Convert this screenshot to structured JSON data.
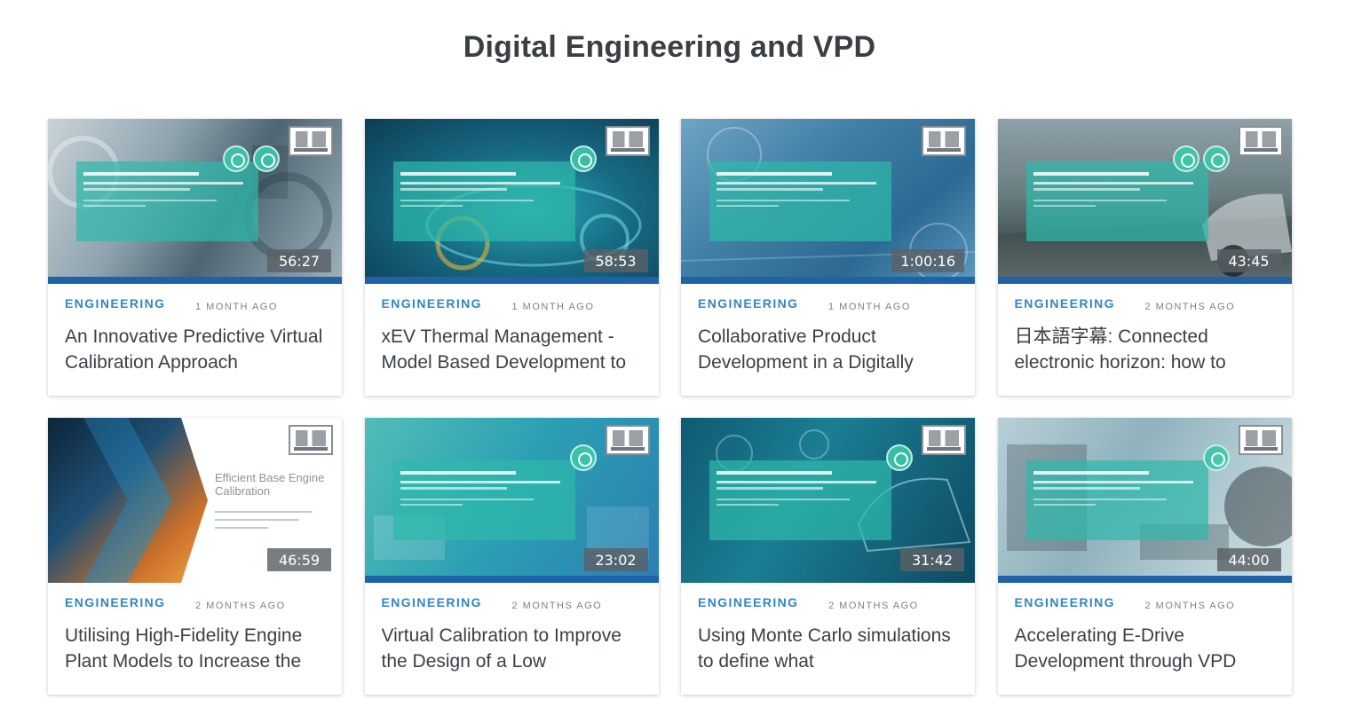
{
  "section": {
    "title": "Digital Engineering and VPD"
  },
  "cards": [
    {
      "category": "ENGINEERING",
      "date": "1 MONTH AGO",
      "duration": "56:27",
      "title": "An Innovative Predictive Virtual Calibration Approach"
    },
    {
      "category": "ENGINEERING",
      "date": "1 MONTH AGO",
      "duration": "58:53",
      "title": "xEV Thermal Management - Model Based Development to"
    },
    {
      "category": "ENGINEERING",
      "date": "1 MONTH AGO",
      "duration": "1:00:16",
      "title": "Collaborative Product Development in a Digitally"
    },
    {
      "category": "ENGINEERING",
      "date": "2 MONTHS AGO",
      "duration": "43:45",
      "title": "日本語字幕: Connected electronic horizon: how to"
    },
    {
      "category": "ENGINEERING",
      "date": "2 MONTHS AGO",
      "duration": "46:59",
      "title": "Utilising High-Fidelity Engine Plant Models to Increase the",
      "thumb_text": "Efficient Base Engine Calibration"
    },
    {
      "category": "ENGINEERING",
      "date": "2 MONTHS AGO",
      "duration": "23:02",
      "title": "Virtual Calibration to Improve the Design of a Low"
    },
    {
      "category": "ENGINEERING",
      "date": "2 MONTHS AGO",
      "duration": "31:42",
      "title": "Using Monte Carlo simulations to define what"
    },
    {
      "category": "ENGINEERING",
      "date": "2 MONTHS AGO",
      "duration": "44:00",
      "title": "Accelerating E-Drive Development through VPD"
    }
  ],
  "colors": {
    "category": "#2f86c8",
    "title": "#3b4047",
    "heading": "#3a3f44",
    "brand_bar": "#1e63a8"
  },
  "icons": {
    "logo": "ricardo-logo",
    "badge": "hexagon-badge-icon"
  }
}
